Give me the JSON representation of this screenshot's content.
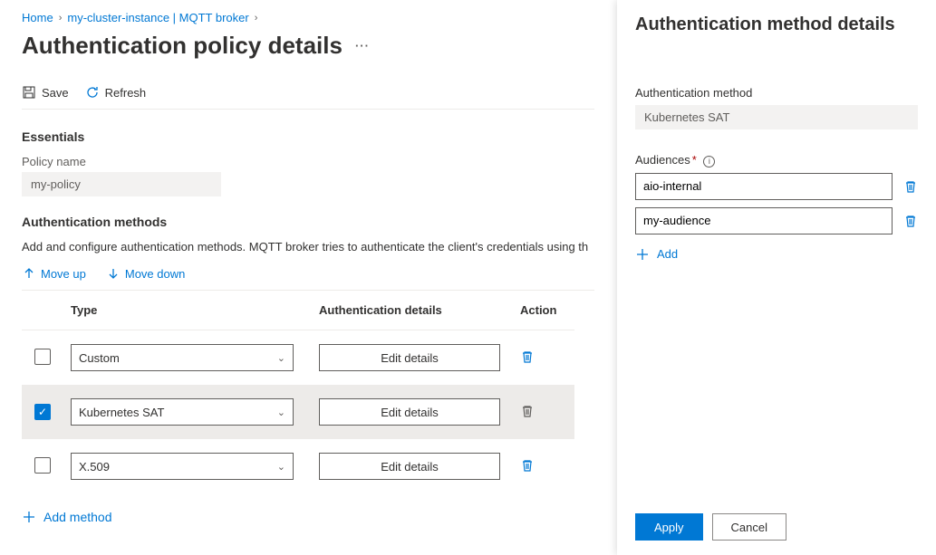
{
  "breadcrumb": {
    "items": [
      "Home",
      "my-cluster-instance | MQTT broker"
    ]
  },
  "page": {
    "title": "Authentication policy details"
  },
  "toolbar": {
    "save": "Save",
    "refresh": "Refresh"
  },
  "essentials": {
    "heading": "Essentials",
    "policy_name_label": "Policy name",
    "policy_name_value": "my-policy"
  },
  "methods": {
    "heading": "Authentication methods",
    "description": "Add and configure authentication methods. MQTT broker tries to authenticate the client's credentials using th",
    "move_up": "Move up",
    "move_down": "Move down",
    "col_type": "Type",
    "col_auth": "Authentication details",
    "col_action": "Action",
    "edit_label": "Edit details",
    "rows": [
      {
        "type": "Custom",
        "selected": false
      },
      {
        "type": "Kubernetes SAT",
        "selected": true
      },
      {
        "type": "X.509",
        "selected": false
      }
    ],
    "add_method": "Add method"
  },
  "panel": {
    "title": "Authentication method details",
    "method_label": "Authentication method",
    "method_value": "Kubernetes SAT",
    "audiences_label": "Audiences",
    "audiences": [
      "aio-internal",
      "my-audience"
    ],
    "add": "Add",
    "apply": "Apply",
    "cancel": "Cancel"
  }
}
